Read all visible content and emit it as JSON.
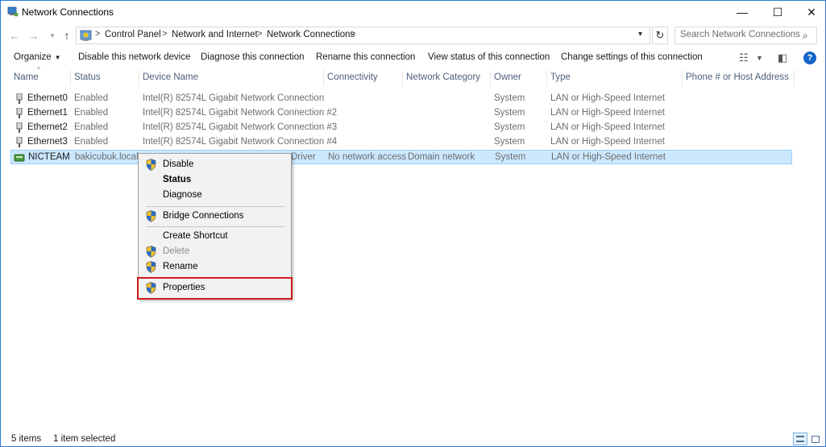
{
  "window": {
    "title": "Network Connections",
    "controls": {
      "minimize": "—",
      "maximize": "☐",
      "close": "✕"
    }
  },
  "address_bar": {
    "breadcrumb": [
      "Control Panel",
      "Network and Internet",
      "Network Connections"
    ],
    "separator": ">",
    "search_placeholder": "Search Network Connections"
  },
  "commands": {
    "organize": "Organize",
    "disable": "Disable this network device",
    "diagnose": "Diagnose this connection",
    "rename": "Rename this connection",
    "view_status": "View status of this connection",
    "change_settings": "Change settings of this connection"
  },
  "columns": [
    "Name",
    "Status",
    "Device Name",
    "Connectivity",
    "Network Category",
    "Owner",
    "Type",
    "Phone # or Host Address"
  ],
  "rows": [
    {
      "name": "Ethernet0",
      "status": "Enabled",
      "device": "Intel(R) 82574L Gigabit Network Connection",
      "connectivity": "",
      "category": "",
      "owner": "System",
      "type": "LAN or High-Speed Internet"
    },
    {
      "name": "Ethernet1",
      "status": "Enabled",
      "device": "Intel(R) 82574L Gigabit Network Connection #2",
      "connectivity": "",
      "category": "",
      "owner": "System",
      "type": "LAN or High-Speed Internet"
    },
    {
      "name": "Ethernet2",
      "status": "Enabled",
      "device": "Intel(R) 82574L Gigabit Network Connection #3",
      "connectivity": "",
      "category": "",
      "owner": "System",
      "type": "LAN or High-Speed Internet"
    },
    {
      "name": "Ethernet3",
      "status": "Enabled",
      "device": "Intel(R) 82574L Gigabit Network Connection #4",
      "connectivity": "",
      "category": "",
      "owner": "System",
      "type": "LAN or High-Speed Internet"
    },
    {
      "name": "NICTEAM",
      "status": "bakicubuk.local",
      "device": "Driver",
      "connectivity": "No network access",
      "category": "Domain network",
      "owner": "System",
      "type": "LAN or High-Speed Internet"
    }
  ],
  "context_menu": {
    "disable": "Disable",
    "status": "Status",
    "diagnose": "Diagnose",
    "bridge": "Bridge Connections",
    "create_shortcut": "Create Shortcut",
    "delete": "Delete",
    "rename": "Rename",
    "properties": "Properties"
  },
  "status_bar": {
    "item_count": "5 items",
    "selected_count": "1 item selected"
  },
  "colors": {
    "selection_bg": "#cce8ff",
    "highlight_border": "#d11a1a",
    "accent": "#1464c8"
  }
}
